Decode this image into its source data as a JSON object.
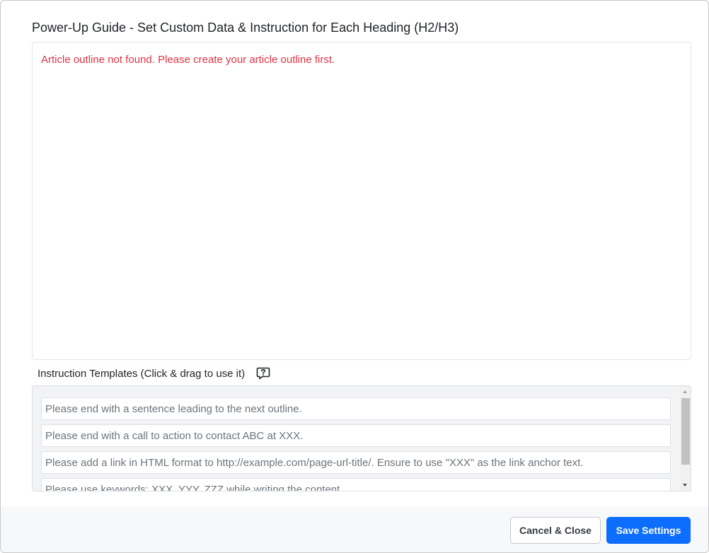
{
  "modal": {
    "title": "Power-Up Guide - Set Custom Data & Instruction for Each Heading (H2/H3)"
  },
  "outline": {
    "error_message": "Article outline not found. Please create your article outline first.",
    "error_color": "#dc3545"
  },
  "templates": {
    "label": "Instruction Templates (Click & drag to use it)",
    "help_icon": "help-speech-bubble-icon",
    "items": [
      "Please end with a sentence leading to the next outline.",
      "Please end with a call to action to contact ABC at XXX.",
      "Please add a link in HTML format to http://example.com/page-url-title/. Ensure to use \"XXX\" as the link anchor text.",
      "Please use keywords: XXX, YYY, ZZZ while writing the content."
    ]
  },
  "footer": {
    "cancel_label": "Cancel & Close",
    "save_label": "Save Settings",
    "save_color": "#0d6efd"
  }
}
